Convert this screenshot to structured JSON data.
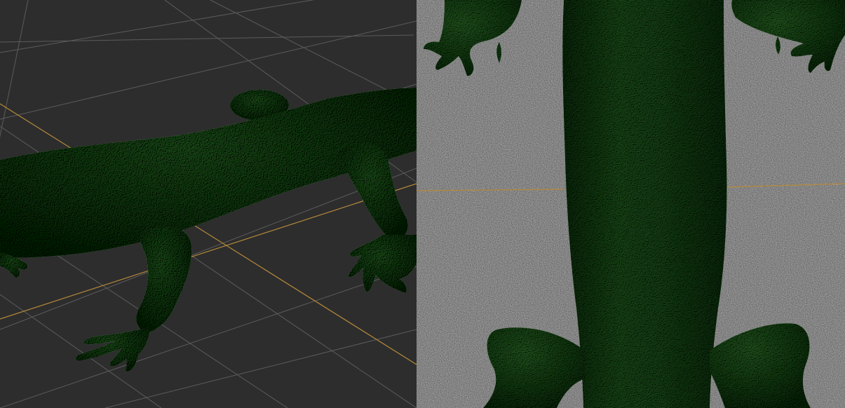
{
  "app": {
    "viewports": [
      {
        "id": "perspective",
        "view": "perspective",
        "background": "#2d2d2d",
        "grid_color": "#5c5c5c",
        "axis_color": "#b5893a"
      },
      {
        "id": "top",
        "view": "top-down",
        "background": "#3e3e3e",
        "axis_color": "#b5893a"
      }
    ],
    "model": {
      "subject": "lizard",
      "surface_color": "#2f5a2f",
      "shadow_color": "#1a3a1c",
      "highlight_color": "#4d7f4b"
    },
    "icons": {
      "grid": "ground-grid",
      "axis": "world-axis-line"
    }
  }
}
